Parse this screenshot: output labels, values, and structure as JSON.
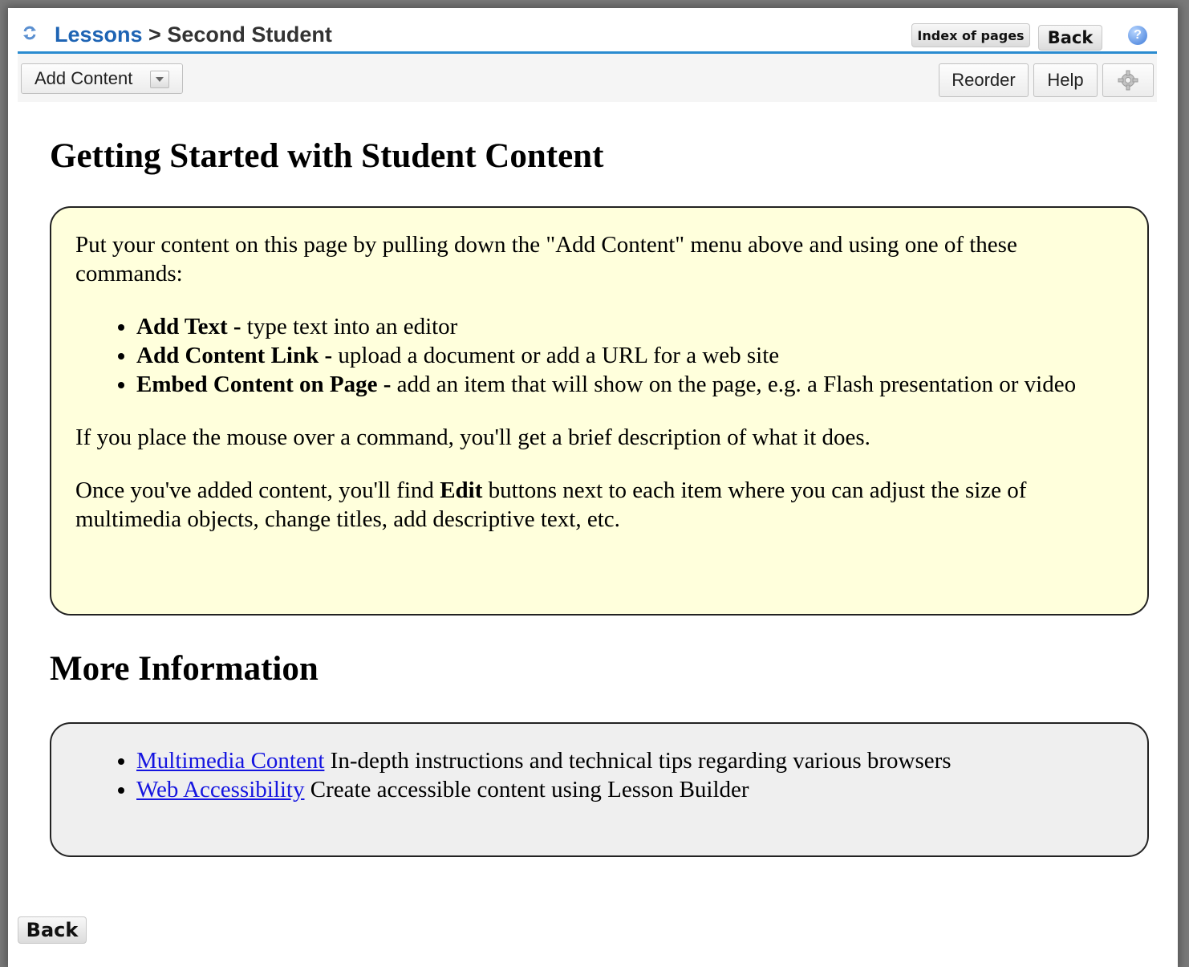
{
  "header": {
    "breadcrumb_link": "Lessons",
    "breadcrumb_sep": " > ",
    "breadcrumb_current": "Second Student",
    "index_button": "Index of pages",
    "back_button": "Back",
    "help_glyph": "?"
  },
  "toolbar": {
    "add_content": "Add Content",
    "reorder": "Reorder",
    "help": "Help",
    "settings_icon": "gear-icon"
  },
  "main": {
    "title": "Getting Started with Student Content",
    "intro": "Put your content on this page by pulling down the \"Add Content\" menu above and using one of these commands:",
    "commands": [
      {
        "name": "Add Text -",
        "desc": " type text into an editor"
      },
      {
        "name": "Add Content Link -",
        "desc": " upload a document or add a URL for a web site"
      },
      {
        "name": "Embed Content on Page -",
        "desc": " add an item that will show on the page, e.g. a Flash presentation or video"
      }
    ],
    "hover_note": "If you place the mouse over a command, you'll get a brief description of what it does.",
    "edit_note_pre": "Once you've added content, you'll find ",
    "edit_note_bold": "Edit",
    "edit_note_post": " buttons next to each item where you can adjust the size of multimedia objects, change titles, add descriptive text, etc.",
    "more_title": "More Information",
    "more_links": [
      {
        "link": "Multimedia Content",
        "desc": " In-depth instructions and technical tips regarding various browsers"
      },
      {
        "link": "Web Accessibility",
        "desc": " Create accessible content using Lesson Builder"
      }
    ]
  },
  "footer": {
    "back_button": "Back"
  },
  "colors": {
    "accent": "#2a8bd0",
    "link": "#1515e0",
    "info_box": "#ffffdc",
    "more_box": "#efefef"
  }
}
